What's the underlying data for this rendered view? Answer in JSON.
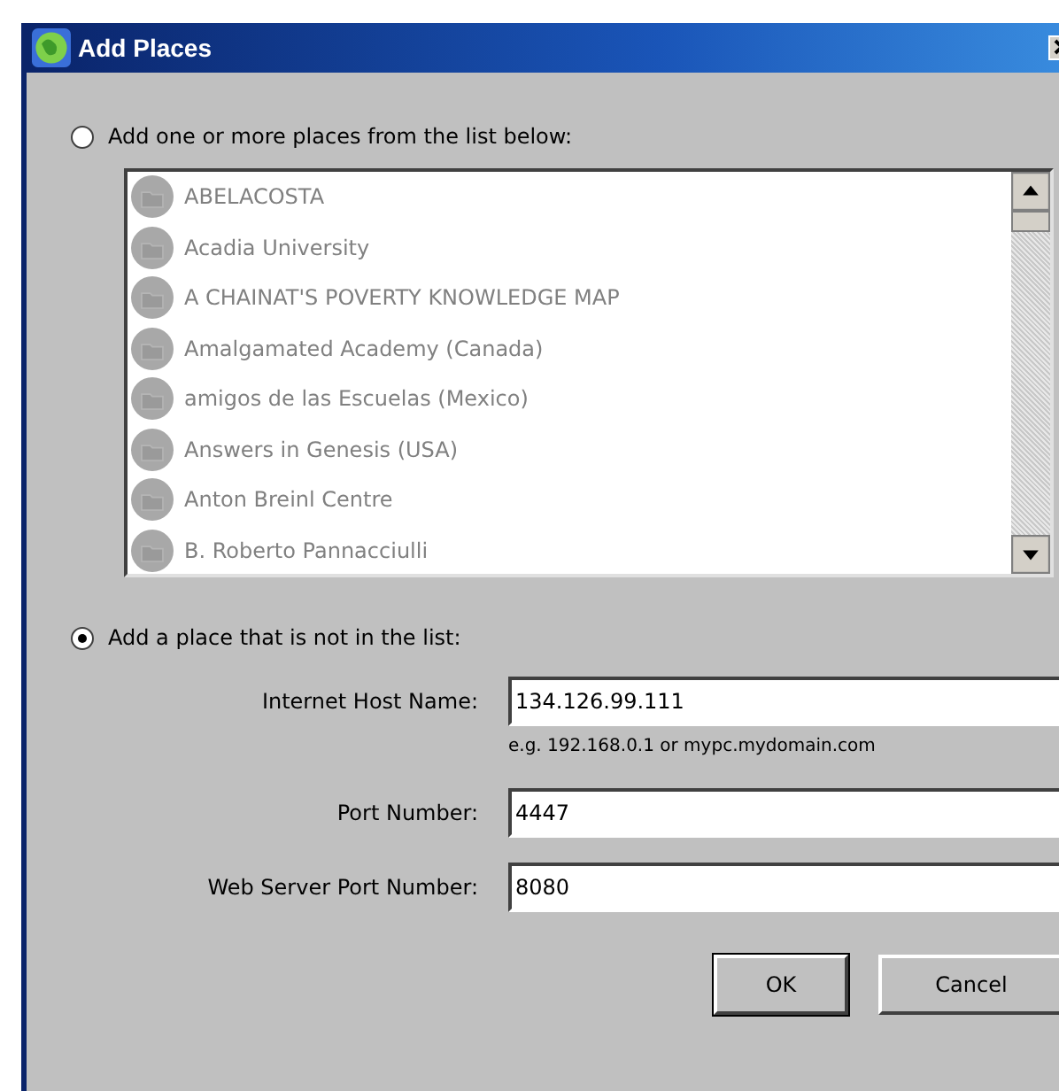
{
  "window": {
    "title": "Add Places"
  },
  "options": [
    {
      "label": "Add one or more places from the list below:",
      "selected": false
    },
    {
      "label": "Add a place that is not in the list:",
      "selected": true
    }
  ],
  "places_list": {
    "disabled": true,
    "items": [
      "ABELACOSTA",
      "Acadia University",
      "A CHAINAT'S POVERTY KNOWLEDGE MAP",
      "Amalgamated Academy (Canada)",
      "amigos de las Escuelas (Mexico)",
      "Answers in Genesis (USA)",
      "Anton Breinl Centre",
      "B. Roberto Pannacciulli"
    ]
  },
  "fields": [
    {
      "label": "Internet Host Name:",
      "value": "134.126.99.111",
      "hint": "e.g. 192.168.0.1 or mypc.mydomain.com"
    },
    {
      "label": "Port Number:",
      "value": "4447"
    },
    {
      "label": "Web Server Port Number:",
      "value": "8080"
    }
  ],
  "buttons": [
    "OK",
    "Cancel"
  ]
}
